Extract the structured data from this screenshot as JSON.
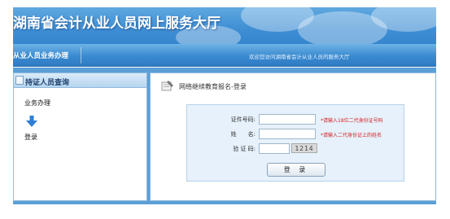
{
  "header": {
    "title": "湖南省会计从业人员网上服务大厅"
  },
  "navbar": {
    "section_label": "从业人员业务办理",
    "welcome_text": "欢迎您访问湖南省会计从业人员的服务大厅"
  },
  "sidebar": {
    "header": "持证人员查询",
    "items": [
      {
        "label": "业务办理"
      },
      {
        "label": "登录"
      }
    ]
  },
  "main": {
    "breadcrumb": "网络继续教育报名-登录",
    "form": {
      "cert_label": "证件号码:",
      "cert_value": "",
      "cert_hint": "*请输入18位二代身份证号码",
      "name_label": "姓　　名:",
      "name_value": "",
      "name_hint": "*请输入二代身份证上的姓名",
      "captcha_label": "验 证 码:",
      "captcha_value": "",
      "captcha_code": "1214",
      "login_label": "登 录"
    }
  },
  "colors": {
    "banner": "#3f8ed4",
    "navbar": "#3a8ad0",
    "panel_bg": "#5b9fd6",
    "hint": "#d42020"
  }
}
